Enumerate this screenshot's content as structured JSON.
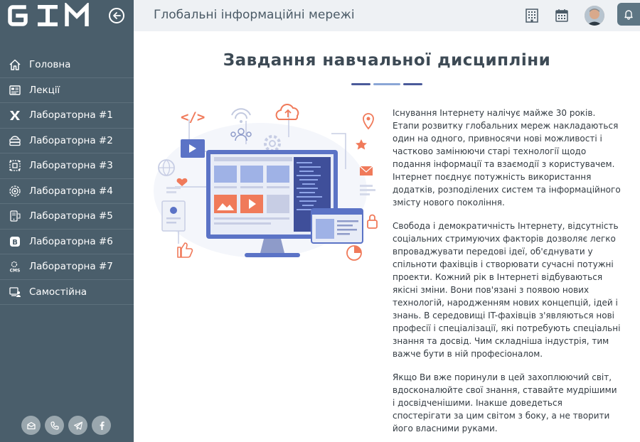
{
  "app": {
    "logo_text": "GIM",
    "title": "Глобальні інформаційні мережі"
  },
  "sidebar": {
    "items": [
      {
        "label": "Головна",
        "icon": "home-icon"
      },
      {
        "label": "Лекції",
        "icon": "lectures-icon"
      },
      {
        "label": "Лабораторна #1",
        "icon": "xml-icon"
      },
      {
        "label": "Лабораторна #2",
        "icon": "server-icon"
      },
      {
        "label": "Лабораторна #3",
        "icon": "network-icon"
      },
      {
        "label": "Лабораторна #4",
        "icon": "gear-target-icon"
      },
      {
        "label": "Лабораторна #5",
        "icon": "mobile-icon"
      },
      {
        "label": "Лабораторна #6",
        "icon": "bootstrap-icon"
      },
      {
        "label": "Лабораторна #7",
        "icon": "cms-icon"
      },
      {
        "label": "Самостійна",
        "icon": "self-study-icon"
      }
    ],
    "social": [
      "mail-icon",
      "phone-icon",
      "telegram-icon",
      "facebook-icon"
    ]
  },
  "content": {
    "heading": "Завдання навчальної дисципліни",
    "paragraphs": [
      "Існування Інтернету налічує майже 30 років. Етапи розвитку глобальних мереж накладаються один на одного, привносячи нові можливості і частково замінюючи старі технології щодо подання інформації та взаємодії з користувачем. Інтернет поєднує потужність використання додатків, розподілених систем та інформаційного змісту нового покоління.",
      "Свобода і демократичність Інтернету, відсутність соціальних стримуючих факторів дозволяє легко впроваджувати передові ідеї, об'єднувати у спільноти фахівців і створювати сучасні потужні проекти. Кожний рік в Інтернеті відбуваються якісні зміни. Вони пов'язані з появою нових технологій, народженням нових концепцій, ідей і знань. В середовищі IT-фахівців з'являються нові професії і спеціалізації, які потребують спеціальні знання та досвід. Чим складніша індустрія, тим важче бути в ній професіоналом.",
      "Якщо Ви вже поринули в цей захоплюючий світ, вдосконалюйте свої знання, ставайте мудрішими і досвідченішими. Інакше доведеться спостерігати за цим світом з боку, а не творити його власними руками."
    ],
    "code_tag": "</>"
  },
  "colors": {
    "sidebar_bg": "#4a5e6b",
    "topbar_bg": "#eef1f4",
    "accent_orange": "#f07a5a",
    "accent_blue": "#5b73c6"
  }
}
